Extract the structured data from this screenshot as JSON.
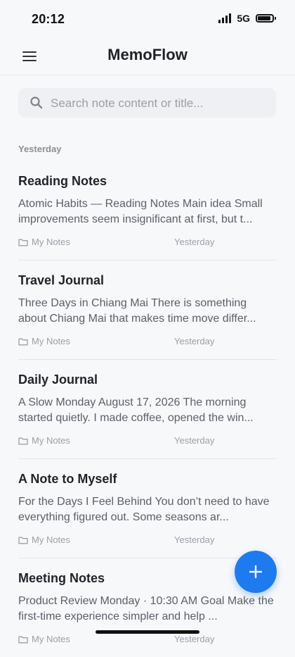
{
  "status_bar": {
    "time": "20:12",
    "network": "5G"
  },
  "header": {
    "title": "MemoFlow"
  },
  "search": {
    "placeholder": "Search note content or title..."
  },
  "section": {
    "label": "Yesterday"
  },
  "notes": [
    {
      "title": "Reading Notes",
      "snippet": "Atomic Habits — Reading Notes Main idea Small improvements seem insignificant at first, but t...",
      "folder": "My Notes",
      "date": "Yesterday"
    },
    {
      "title": "Travel Journal",
      "snippet": "Three Days in Chiang Mai There is something about Chiang Mai that makes time move differ...",
      "folder": "My Notes",
      "date": "Yesterday"
    },
    {
      "title": "Daily Journal",
      "snippet": "A Slow Monday August 17, 2026 The morning started quietly. I made coffee, opened the win...",
      "folder": "My Notes",
      "date": "Yesterday"
    },
    {
      "title": "A Note to Myself",
      "snippet": "For the Days I Feel Behind You don’t need to have everything figured out. Some seasons ar...",
      "folder": "My Notes",
      "date": "Yesterday"
    },
    {
      "title": "Meeting Notes",
      "snippet": "Product Review Monday · 10:30 AM Goal Make the first-time experience simpler and help ...",
      "folder": "My Notes",
      "date": "Yesterday"
    }
  ],
  "colors": {
    "accent": "#1e7bef",
    "background": "#f7f8fa"
  },
  "icons": {
    "menu": "hamburger-icon",
    "search": "search-icon",
    "folder": "folder-icon",
    "add": "plus-icon"
  }
}
